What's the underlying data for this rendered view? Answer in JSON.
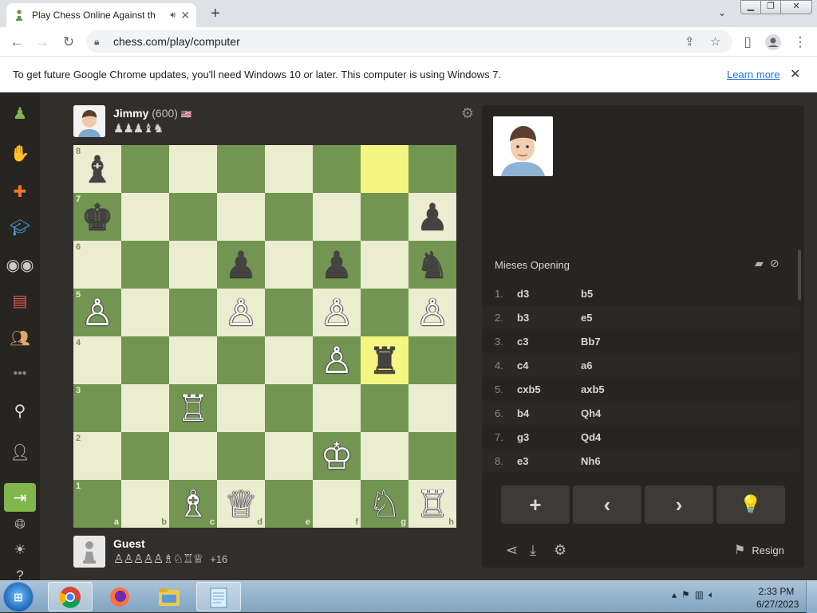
{
  "browser": {
    "tab_title": "Play Chess Online Against th",
    "tab_icons": {
      "favicon": "chess-pawn-icon",
      "audio": "speaker-icon",
      "close": "close-icon"
    },
    "new_tab": "+",
    "url": "chess.com/play/computer",
    "window_buttons": [
      "minimize",
      "maximize",
      "close"
    ]
  },
  "infobar": {
    "message": "To get future Google Chrome updates, you'll need Windows 10 or later. This computer is using Windows 7.",
    "link": "Learn more"
  },
  "sidebar": {
    "items": [
      "play-icon",
      "puzzle-hand-icon",
      "puzzles-icon",
      "learn-icon",
      "watch-icon",
      "news-icon",
      "social-icon",
      "more-icon",
      "search-icon",
      "add-friend-icon",
      "login-icon",
      "language-icon",
      "theme-icon",
      "help-icon"
    ]
  },
  "opponent": {
    "name": "Jimmy",
    "rating": "(600)",
    "flag": "🇺🇸",
    "captured": "♟♟♟♝♞"
  },
  "player": {
    "name": "Guest",
    "captured": "♙♙♙♙♙♗♘♖♕",
    "advantage": "+16"
  },
  "board": {
    "files": [
      "a",
      "b",
      "c",
      "d",
      "e",
      "f",
      "g",
      "h"
    ],
    "ranks": [
      "8",
      "7",
      "6",
      "5",
      "4",
      "3",
      "2",
      "1"
    ],
    "highlight": [
      "g8",
      "g4"
    ],
    "pieces": {
      "a8": "♝",
      "a7": "♚",
      "h7": "♟",
      "d6": "♟",
      "f6": "♟",
      "h6": "♞",
      "a5": "♙",
      "d5": "♙",
      "f5": "♙",
      "h5": "♙",
      "f4": "♙",
      "g4": "♜",
      "c3": "♖",
      "f2": "♔",
      "c1": "♗",
      "d1": "♕",
      "g1": "♘",
      "h1": "♖"
    },
    "white": [
      "a5",
      "d5",
      "f5",
      "h5",
      "f4",
      "c3",
      "f2",
      "c1",
      "d1",
      "g1",
      "h1"
    ],
    "colors": {
      "light": "#ebecd0",
      "dark": "#739552",
      "highlight_light": "#f5f682",
      "highlight_dark": "#f5f682"
    }
  },
  "panel": {
    "opening": "Mieses Opening",
    "moves": [
      {
        "n": "1.",
        "w": "d3",
        "b": "b5"
      },
      {
        "n": "2.",
        "w": "b3",
        "b": "e5"
      },
      {
        "n": "3.",
        "w": "c3",
        "b": "Bb7"
      },
      {
        "n": "4.",
        "w": "c4",
        "b": "a6"
      },
      {
        "n": "5.",
        "w": "cxb5",
        "b": "axb5"
      },
      {
        "n": "6.",
        "w": "b4",
        "b": "Qh4"
      },
      {
        "n": "7.",
        "w": "g3",
        "b": "Qd4"
      },
      {
        "n": "8.",
        "w": "e3",
        "b": "Nh6"
      }
    ],
    "nav": [
      "+",
      "‹",
      "›",
      "💡"
    ],
    "resign": "Resign"
  },
  "taskbar": {
    "time": "2:33 PM",
    "date": "6/27/2023"
  }
}
